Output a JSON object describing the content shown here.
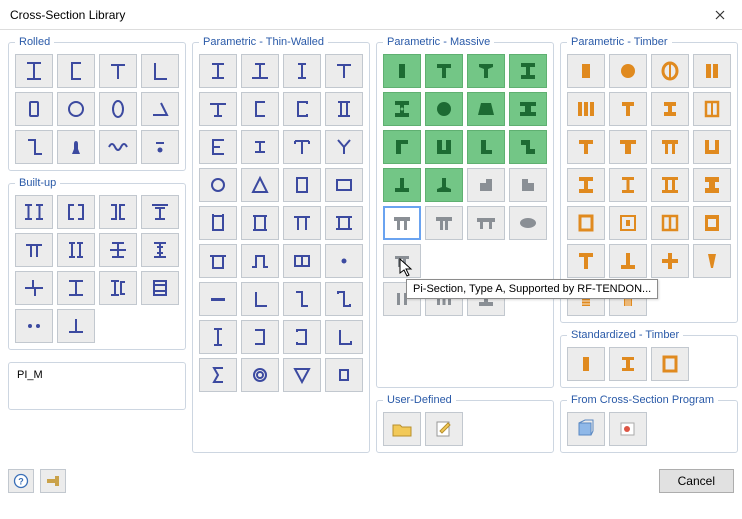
{
  "window": {
    "title": "Cross-Section Library"
  },
  "groups": {
    "rolled": "Rolled",
    "builtup": "Built-up",
    "thin": "Parametric - Thin-Walled",
    "massive": "Parametric - Massive",
    "timber": "Parametric - Timber",
    "std_timber": "Standardized - Timber",
    "user": "User-Defined",
    "program": "From Cross-Section Program"
  },
  "info": {
    "selected": "PI_M"
  },
  "tooltip": {
    "text": "Pi-Section, Type A, Supported by RF-TENDON..."
  },
  "buttons": {
    "cancel": "Cancel"
  },
  "colors": {
    "accent_blue": "#3c4aa0",
    "green_bg": "#73c686",
    "dark_green": "#1d6b33",
    "gray": "#8a8f95",
    "orange": "#e08a1f"
  }
}
